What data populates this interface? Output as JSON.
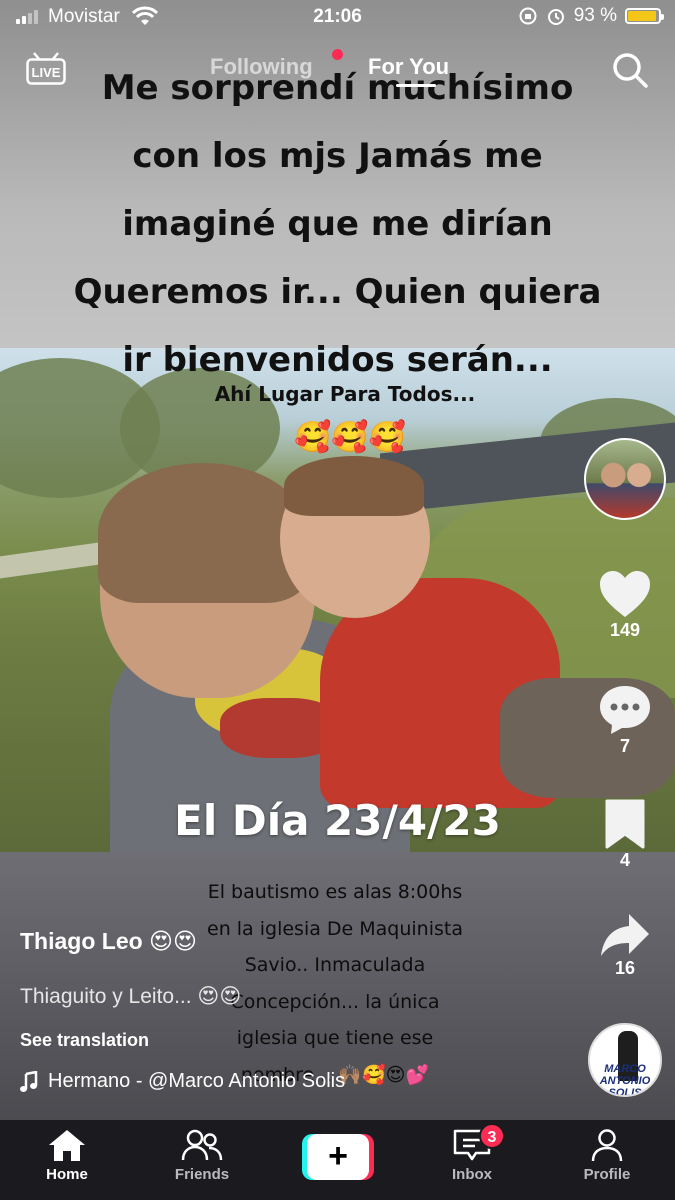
{
  "status_bar": {
    "carrier": "Movistar",
    "time": "21:06",
    "battery_percent": "93 %",
    "battery_level": 0.93,
    "battery_color": "#f3c617"
  },
  "top_nav": {
    "live_label": "LIVE",
    "tabs": [
      {
        "label": "Following",
        "active": false
      },
      {
        "label": "For You",
        "active": true
      }
    ],
    "search_icon": "search-icon"
  },
  "video": {
    "caption_lines": [
      "Me sorprendí muchísimo",
      "con los mjs Jamás me",
      "imaginé que me dirían",
      "Queremos ir... Quien quiera",
      "ir bienvenidos serán..."
    ],
    "caption_small": "Ahí Lugar Para Todos...",
    "caption_emoji": "🥰🥰🥰",
    "date_text": "El Día 23/4/23",
    "info_lines": [
      "El bautismo es alas 8:00hs",
      "en la iglesia De Maquinista",
      "Savio.. Inmaculada",
      "Concepción... la única",
      "iglesia que tiene ese",
      "nombre... 🙌🏽🥰😍💕"
    ]
  },
  "rail": {
    "likes": "149",
    "comments": "7",
    "saves": "4",
    "shares": "16",
    "disc_label": "MARCO ANTONIO SOLIS"
  },
  "post": {
    "username": "Thiago Leo 😍😍",
    "description": "Thiaguito y Leito... 😍😍",
    "translate": "See translation",
    "music": "Hermano - @Marco Antonio Solis"
  },
  "bottom_nav": {
    "items": [
      {
        "label": "Home",
        "active": true
      },
      {
        "label": "Friends",
        "active": false
      },
      {
        "label": "Inbox",
        "active": false
      },
      {
        "label": "Profile",
        "active": false
      }
    ],
    "inbox_badge": "3",
    "accent_colors": {
      "cyan": "#25f4ee",
      "red": "#fe2c55"
    }
  }
}
